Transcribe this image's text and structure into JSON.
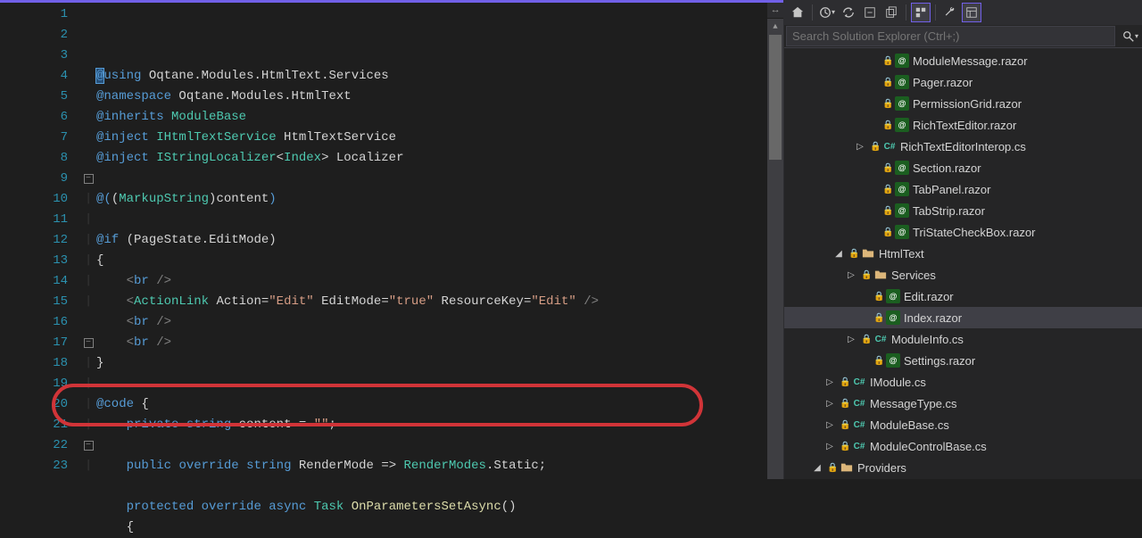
{
  "search": {
    "placeholder": "Search Solution Explorer (Ctrl+;)"
  },
  "tree": {
    "items": [
      {
        "indent": 88,
        "expander": "",
        "lock": true,
        "icon": "razor",
        "label": "ModuleMessage.razor"
      },
      {
        "indent": 88,
        "expander": "",
        "lock": true,
        "icon": "razor",
        "label": "Pager.razor"
      },
      {
        "indent": 88,
        "expander": "",
        "lock": true,
        "icon": "razor",
        "label": "PermissionGrid.razor"
      },
      {
        "indent": 88,
        "expander": "",
        "lock": true,
        "icon": "razor",
        "label": "RichTextEditor.razor"
      },
      {
        "indent": 74,
        "expander": "▷",
        "lock": true,
        "icon": "cs",
        "label": "RichTextEditorInterop.cs"
      },
      {
        "indent": 88,
        "expander": "",
        "lock": true,
        "icon": "razor",
        "label": "Section.razor"
      },
      {
        "indent": 88,
        "expander": "",
        "lock": true,
        "icon": "razor",
        "label": "TabPanel.razor"
      },
      {
        "indent": 88,
        "expander": "",
        "lock": true,
        "icon": "razor",
        "label": "TabStrip.razor"
      },
      {
        "indent": 88,
        "expander": "",
        "lock": true,
        "icon": "razor",
        "label": "TriStateCheckBox.razor"
      },
      {
        "indent": 50,
        "expander": "◢",
        "lock": true,
        "icon": "folder",
        "label": "HtmlText"
      },
      {
        "indent": 64,
        "expander": "▷",
        "lock": true,
        "icon": "folder",
        "label": "Services"
      },
      {
        "indent": 78,
        "expander": "",
        "lock": true,
        "icon": "razor",
        "label": "Edit.razor"
      },
      {
        "indent": 78,
        "expander": "",
        "lock": true,
        "icon": "razor",
        "label": "Index.razor",
        "selected": true
      },
      {
        "indent": 64,
        "expander": "▷",
        "lock": true,
        "icon": "cs",
        "label": "ModuleInfo.cs"
      },
      {
        "indent": 78,
        "expander": "",
        "lock": true,
        "icon": "razor",
        "label": "Settings.razor"
      },
      {
        "indent": 40,
        "expander": "▷",
        "lock": true,
        "icon": "cs",
        "label": "IModule.cs"
      },
      {
        "indent": 40,
        "expander": "▷",
        "lock": true,
        "icon": "cs",
        "label": "MessageType.cs"
      },
      {
        "indent": 40,
        "expander": "▷",
        "lock": true,
        "icon": "cs",
        "label": "ModuleBase.cs"
      },
      {
        "indent": 40,
        "expander": "▷",
        "lock": true,
        "icon": "cs",
        "label": "ModuleControlBase.cs"
      },
      {
        "indent": 26,
        "expander": "◢",
        "lock": true,
        "icon": "folder",
        "label": "Providers"
      }
    ]
  },
  "code": {
    "lines": [
      {
        "n": 1,
        "fold": "",
        "html": "<span class='cursor-hl'><span class='dir'>@</span></span><span class='kw'>using</span> <span class='id'>Oqtane</span><span class='punc'>.</span><span class='id'>Modules</span><span class='punc'>.</span><span class='id'>HtmlText</span><span class='punc'>.</span><span class='id'>Services</span>"
      },
      {
        "n": 2,
        "fold": "",
        "html": "<span class='dir'>@namespace</span> <span class='id'>Oqtane</span><span class='punc'>.</span><span class='id'>Modules</span><span class='punc'>.</span><span class='id'>HtmlText</span>"
      },
      {
        "n": 3,
        "fold": "",
        "html": "<span class='dir'>@inherits</span> <span class='type'>ModuleBase</span>"
      },
      {
        "n": 4,
        "fold": "",
        "html": "<span class='dir'>@inject</span> <span class='type'>IHtmlTextService</span> <span class='id'>HtmlTextService</span>"
      },
      {
        "n": 5,
        "fold": "",
        "html": "<span class='dir'>@inject</span> <span class='type'>IStringLocalizer</span><span class='punc'>&lt;</span><span class='type'>Index</span><span class='punc'>&gt;</span> <span class='id'>Localizer</span>"
      },
      {
        "n": 6,
        "fold": "",
        "html": ""
      },
      {
        "n": 7,
        "fold": "",
        "html": "<span class='dir'>@(</span><span class='punc'>(</span><span class='type'>MarkupString</span><span class='punc'>)</span><span class='id'>content</span><span class='dir'>)</span>"
      },
      {
        "n": 8,
        "fold": "",
        "html": ""
      },
      {
        "n": 9,
        "fold": "box",
        "html": "<span class='dir'>@</span><span class='kw'>if</span> <span class='punc'>(</span><span class='id'>PageState</span><span class='punc'>.</span><span class='id'>EditMode</span><span class='punc'>)</span>"
      },
      {
        "n": 10,
        "fold": "line",
        "html": "<span class='punc'>{</span>"
      },
      {
        "n": 11,
        "fold": "line",
        "html": "    <span class='gray'>&lt;</span><span class='kw'>br</span> <span class='gray'>/&gt;</span>"
      },
      {
        "n": 12,
        "fold": "line",
        "html": "    <span class='gray'>&lt;</span><span class='type'>ActionLink</span> <span class='id'>Action</span><span class='punc'>=</span><span class='str'>\"Edit\"</span> <span class='id'>EditMode</span><span class='punc'>=</span><span class='str'>\"true\"</span> <span class='id'>ResourceKey</span><span class='punc'>=</span><span class='str'>\"Edit\"</span> <span class='gray'>/&gt;</span>"
      },
      {
        "n": 13,
        "fold": "line",
        "html": "    <span class='gray'>&lt;</span><span class='kw'>br</span> <span class='gray'>/&gt;</span>"
      },
      {
        "n": 14,
        "fold": "line",
        "html": "    <span class='gray'>&lt;</span><span class='kw'>br</span> <span class='gray'>/&gt;</span>"
      },
      {
        "n": 15,
        "fold": "line",
        "html": "<span class='punc'>}</span>"
      },
      {
        "n": 16,
        "fold": "",
        "html": ""
      },
      {
        "n": 17,
        "fold": "box",
        "html": "<span class='dir'>@code</span> <span class='punc'>{</span>"
      },
      {
        "n": 18,
        "fold": "line",
        "html": "    <span class='kw'>private</span> <span class='kw'>string</span> <span class='id'>content</span> <span class='punc'>=</span> <span class='str'>\"\"</span><span class='punc'>;</span>"
      },
      {
        "n": 19,
        "fold": "line",
        "html": ""
      },
      {
        "n": 20,
        "fold": "line",
        "html": "    <span class='kw'>public</span> <span class='kw'>override</span> <span class='kw'>string</span> <span class='id'>RenderMode</span> <span class='punc'>=&gt;</span> <span class='type'>RenderModes</span><span class='punc'>.</span><span class='id'>Static</span><span class='punc'>;</span>"
      },
      {
        "n": 21,
        "fold": "line",
        "html": ""
      },
      {
        "n": 22,
        "fold": "box",
        "html": "    <span class='kw'>protected</span> <span class='kw'>override</span> <span class='kw'>async</span> <span class='type'>Task</span> <span class='meth'>OnParametersSetAsync</span><span class='punc'>()</span>"
      },
      {
        "n": 23,
        "fold": "line",
        "html": "    <span class='punc'>{</span>"
      }
    ]
  }
}
